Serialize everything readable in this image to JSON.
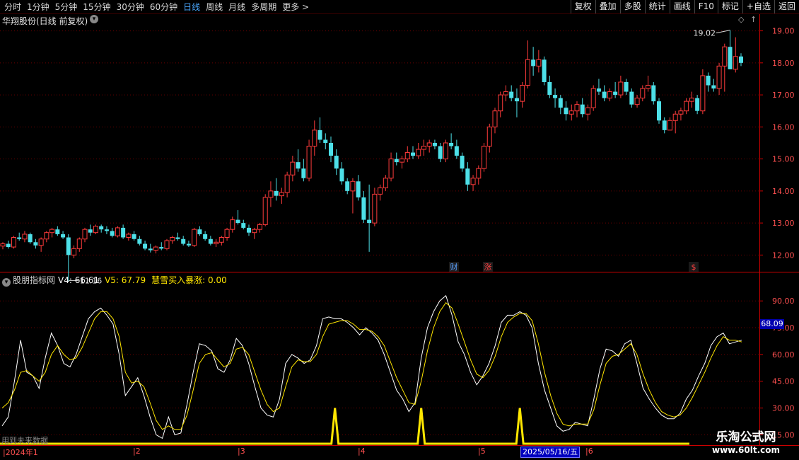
{
  "toolbar": {
    "periods": [
      "分时",
      "1分钟",
      "5分钟",
      "15分钟",
      "30分钟",
      "60分钟",
      "日线",
      "周线",
      "月线",
      "多周期",
      "更多 >"
    ],
    "active_period": 6,
    "right_tools": [
      "复权",
      "叠加",
      "多股",
      "统计",
      "画线",
      "F10",
      "标记",
      "+自选",
      "返回"
    ]
  },
  "main_title": "华翔股份(日线 前复权)",
  "dd_icon": "chevron-down-icon",
  "high_label": "19.02",
  "low_label": "11.16",
  "markers": [
    {
      "text": "财",
      "color": "#5aa0ff"
    },
    {
      "text": "涨",
      "color": "#ff4040"
    },
    {
      "text": "$",
      "color": "#ff4040"
    }
  ],
  "indicator": {
    "name": "股朋指标网",
    "v4_label": "V4: 66.61",
    "v5_label": "V5: 67.79",
    "boom_label": "慧雪买入暴涨: 0.00",
    "current_tag": "68.09"
  },
  "future_note": "用到未来数据",
  "date_axis": {
    "months": [
      "2024年1",
      "2",
      "3",
      "4",
      "5",
      "6"
    ],
    "cursor": "2025/05/16/五"
  },
  "watermark": {
    "name": "乐淘公式网",
    "url": "www.60lt.com"
  },
  "colors": {
    "up": "#ff3b3b",
    "down": "#4de0e8",
    "line_white": "#ffffff",
    "line_yellow": "#ffe600",
    "grid": "#6a0000",
    "axis": "#cc0000"
  },
  "chart_data": [
    {
      "type": "candlestick",
      "ylim": [
        11.5,
        19.3
      ],
      "yticks": [
        "12.00",
        "13.00",
        "14.00",
        "15.00",
        "16.00",
        "17.00",
        "18.00",
        "19.00"
      ],
      "ohlc": [
        [
          12.28,
          12.4,
          12.18,
          12.35
        ],
        [
          12.35,
          12.45,
          12.2,
          12.25
        ],
        [
          12.25,
          12.6,
          12.2,
          12.55
        ],
        [
          12.55,
          12.7,
          12.45,
          12.5
        ],
        [
          12.5,
          12.75,
          12.4,
          12.65
        ],
        [
          12.65,
          12.7,
          12.35,
          12.4
        ],
        [
          12.4,
          12.5,
          12.2,
          12.3
        ],
        [
          12.3,
          12.55,
          12.1,
          12.5
        ],
        [
          12.5,
          12.75,
          12.4,
          12.7
        ],
        [
          12.7,
          12.85,
          12.55,
          12.8
        ],
        [
          12.8,
          12.9,
          12.6,
          12.65
        ],
        [
          12.65,
          12.75,
          12.5,
          12.55
        ],
        [
          12.55,
          12.65,
          11.16,
          12.0
        ],
        [
          12.0,
          12.3,
          11.9,
          12.2
        ],
        [
          12.2,
          12.55,
          12.1,
          12.5
        ],
        [
          12.5,
          12.85,
          12.4,
          12.8
        ],
        [
          12.8,
          12.95,
          12.6,
          12.7
        ],
        [
          12.7,
          12.95,
          12.65,
          12.9
        ],
        [
          12.9,
          12.95,
          12.7,
          12.8
        ],
        [
          12.8,
          12.9,
          12.65,
          12.75
        ],
        [
          12.75,
          12.85,
          12.55,
          12.6
        ],
        [
          12.6,
          12.9,
          12.55,
          12.85
        ],
        [
          12.85,
          12.95,
          12.5,
          12.55
        ],
        [
          12.55,
          12.7,
          12.45,
          12.65
        ],
        [
          12.65,
          12.75,
          12.45,
          12.5
        ],
        [
          12.5,
          12.6,
          12.3,
          12.35
        ],
        [
          12.35,
          12.45,
          12.15,
          12.2
        ],
        [
          12.2,
          12.35,
          12.08,
          12.15
        ],
        [
          12.15,
          12.3,
          12.05,
          12.25
        ],
        [
          12.25,
          12.4,
          12.15,
          12.2
        ],
        [
          12.2,
          12.5,
          12.15,
          12.45
        ],
        [
          12.45,
          12.6,
          12.35,
          12.55
        ],
        [
          12.55,
          12.7,
          12.45,
          12.5
        ],
        [
          12.5,
          12.6,
          12.3,
          12.35
        ],
        [
          12.35,
          12.45,
          12.25,
          12.3
        ],
        [
          12.3,
          12.85,
          12.25,
          12.8
        ],
        [
          12.8,
          12.9,
          12.6,
          12.65
        ],
        [
          12.65,
          12.75,
          12.45,
          12.5
        ],
        [
          12.5,
          12.6,
          12.3,
          12.35
        ],
        [
          12.35,
          12.5,
          12.25,
          12.4
        ],
        [
          12.4,
          12.6,
          12.3,
          12.55
        ],
        [
          12.55,
          12.85,
          12.45,
          12.8
        ],
        [
          12.8,
          13.2,
          12.7,
          13.1
        ],
        [
          13.1,
          13.4,
          12.95,
          13.0
        ],
        [
          13.0,
          13.1,
          12.8,
          12.85
        ],
        [
          12.85,
          12.95,
          12.6,
          12.7
        ],
        [
          12.7,
          12.85,
          12.5,
          12.8
        ],
        [
          12.8,
          13.0,
          12.7,
          12.95
        ],
        [
          12.95,
          13.9,
          12.9,
          13.8
        ],
        [
          13.8,
          14.3,
          13.5,
          14.0
        ],
        [
          14.0,
          14.4,
          13.7,
          13.85
        ],
        [
          13.85,
          14.1,
          13.6,
          13.95
        ],
        [
          13.95,
          14.6,
          13.8,
          14.5
        ],
        [
          14.5,
          15.1,
          14.3,
          14.9
        ],
        [
          14.9,
          15.3,
          14.6,
          14.7
        ],
        [
          14.7,
          15.0,
          14.3,
          14.4
        ],
        [
          14.4,
          15.6,
          14.3,
          15.4
        ],
        [
          15.4,
          16.2,
          15.1,
          15.9
        ],
        [
          15.9,
          16.3,
          15.5,
          15.6
        ],
        [
          15.6,
          15.8,
          15.3,
          15.5
        ],
        [
          15.5,
          15.7,
          14.9,
          15.1
        ],
        [
          15.1,
          15.3,
          14.5,
          14.7
        ],
        [
          14.7,
          14.9,
          14.2,
          14.3
        ],
        [
          14.3,
          14.4,
          13.9,
          14.0
        ],
        [
          14.0,
          14.4,
          13.3,
          14.3
        ],
        [
          14.3,
          14.5,
          13.7,
          13.8
        ],
        [
          13.8,
          14.0,
          13.0,
          13.1
        ],
        [
          13.1,
          14.2,
          12.1,
          13.0
        ],
        [
          13.0,
          14.1,
          12.9,
          13.9
        ],
        [
          13.9,
          14.2,
          13.7,
          14.1
        ],
        [
          14.1,
          14.5,
          14.0,
          14.4
        ],
        [
          14.4,
          15.2,
          14.3,
          15.0
        ],
        [
          15.0,
          15.2,
          14.8,
          14.9
        ],
        [
          14.9,
          15.1,
          14.7,
          15.0
        ],
        [
          15.0,
          15.4,
          14.9,
          15.2
        ],
        [
          15.2,
          15.4,
          15.0,
          15.1
        ],
        [
          15.1,
          15.5,
          15.0,
          15.3
        ],
        [
          15.3,
          15.6,
          15.1,
          15.4
        ],
        [
          15.4,
          15.6,
          15.2,
          15.5
        ],
        [
          15.5,
          15.6,
          15.3,
          15.4
        ],
        [
          15.4,
          15.5,
          14.9,
          15.0
        ],
        [
          15.0,
          15.6,
          14.9,
          15.5
        ],
        [
          15.5,
          15.8,
          15.3,
          15.4
        ],
        [
          15.4,
          15.6,
          15.0,
          15.1
        ],
        [
          15.1,
          15.2,
          14.6,
          14.7
        ],
        [
          14.7,
          14.9,
          14.0,
          14.2
        ],
        [
          14.2,
          14.5,
          14.0,
          14.4
        ],
        [
          14.4,
          14.8,
          14.2,
          14.7
        ],
        [
          14.7,
          15.5,
          14.6,
          15.4
        ],
        [
          15.4,
          16.1,
          15.2,
          16.0
        ],
        [
          16.0,
          16.6,
          15.8,
          16.5
        ],
        [
          16.5,
          17.1,
          16.3,
          17.0
        ],
        [
          17.0,
          17.3,
          16.8,
          17.1
        ],
        [
          17.1,
          17.3,
          16.8,
          16.9
        ],
        [
          16.9,
          17.2,
          16.3,
          16.8
        ],
        [
          16.8,
          17.4,
          16.6,
          17.3
        ],
        [
          17.3,
          18.7,
          17.2,
          18.1
        ],
        [
          18.1,
          18.5,
          17.6,
          17.9
        ],
        [
          17.9,
          18.4,
          17.7,
          18.1
        ],
        [
          18.1,
          18.2,
          17.3,
          17.4
        ],
        [
          17.4,
          17.6,
          16.9,
          17.0
        ],
        [
          17.0,
          17.2,
          16.6,
          16.9
        ],
        [
          16.9,
          17.0,
          16.4,
          16.6
        ],
        [
          16.6,
          16.8,
          16.2,
          16.4
        ],
        [
          16.4,
          16.7,
          16.2,
          16.5
        ],
        [
          16.5,
          16.8,
          16.3,
          16.7
        ],
        [
          16.7,
          16.9,
          16.3,
          16.4
        ],
        [
          16.4,
          16.7,
          16.2,
          16.6
        ],
        [
          16.6,
          17.3,
          16.5,
          17.2
        ],
        [
          17.2,
          17.5,
          17.0,
          17.1
        ],
        [
          17.1,
          17.3,
          16.8,
          16.9
        ],
        [
          16.9,
          17.2,
          16.8,
          17.1
        ],
        [
          17.1,
          17.4,
          16.9,
          17.0
        ],
        [
          17.0,
          17.6,
          16.9,
          17.4
        ],
        [
          17.4,
          17.5,
          17.0,
          17.1
        ],
        [
          17.1,
          17.2,
          16.6,
          16.7
        ],
        [
          16.7,
          17.0,
          16.6,
          16.9
        ],
        [
          16.9,
          17.3,
          16.8,
          17.2
        ],
        [
          17.2,
          17.6,
          17.1,
          17.3
        ],
        [
          17.3,
          17.4,
          16.7,
          16.8
        ],
        [
          16.8,
          16.9,
          16.1,
          16.2
        ],
        [
          16.2,
          16.3,
          15.8,
          15.9
        ],
        [
          15.9,
          16.3,
          15.9,
          16.2
        ],
        [
          16.2,
          16.5,
          15.8,
          16.4
        ],
        [
          16.4,
          16.6,
          16.2,
          16.5
        ],
        [
          16.5,
          16.9,
          16.4,
          16.8
        ],
        [
          16.8,
          17.1,
          16.6,
          16.9
        ],
        [
          16.9,
          17.0,
          16.4,
          16.5
        ],
        [
          16.5,
          17.8,
          16.4,
          17.6
        ],
        [
          17.6,
          17.7,
          17.1,
          17.3
        ],
        [
          17.3,
          17.5,
          17.1,
          17.2
        ],
        [
          17.2,
          18.0,
          17.0,
          17.9
        ],
        [
          17.9,
          18.6,
          17.1,
          18.5
        ],
        [
          18.5,
          19.02,
          17.8,
          17.8
        ],
        [
          17.8,
          18.8,
          17.7,
          18.2
        ],
        [
          18.2,
          18.3,
          17.9,
          18.0
        ]
      ]
    },
    {
      "type": "line",
      "ylim": [
        10,
        100
      ],
      "yticks": [
        "15.00",
        "30.00",
        "45.00",
        "60.00",
        "75.00",
        "90.00"
      ],
      "series": [
        {
          "name": "V4",
          "values": [
            20,
            25,
            45,
            68,
            50,
            48,
            41,
            58,
            72,
            65,
            55,
            53,
            60,
            70,
            80,
            84,
            86,
            82,
            77,
            60,
            37,
            42,
            47,
            37,
            25,
            15,
            13,
            25,
            15,
            16,
            32,
            50,
            66,
            65,
            62,
            52,
            50,
            57,
            69,
            65,
            55,
            42,
            30,
            26,
            25,
            35,
            55,
            60,
            58,
            55,
            57,
            65,
            80,
            81,
            80,
            80,
            78,
            75,
            71,
            75,
            72,
            68,
            60,
            50,
            40,
            35,
            28,
            33,
            58,
            75,
            84,
            90,
            93,
            82,
            67,
            60,
            50,
            43,
            48,
            55,
            65,
            78,
            82,
            82,
            84,
            82,
            75,
            55,
            40,
            30,
            20,
            17,
            18,
            22,
            21,
            20,
            35,
            52,
            63,
            62,
            59,
            66,
            68,
            55,
            41,
            35,
            30,
            26,
            24,
            24,
            27,
            35,
            40,
            48,
            55,
            65,
            70,
            72,
            66,
            67,
            68
          ]
        },
        {
          "name": "V5",
          "values": [
            30,
            33,
            40,
            50,
            51,
            48,
            45,
            50,
            60,
            65,
            60,
            57,
            58,
            64,
            72,
            80,
            84,
            84,
            80,
            70,
            50,
            44,
            45,
            42,
            33,
            23,
            18,
            20,
            18,
            18,
            26,
            40,
            55,
            60,
            61,
            57,
            53,
            55,
            63,
            64,
            60,
            50,
            40,
            32,
            28,
            30,
            42,
            53,
            57,
            56,
            56,
            60,
            70,
            77,
            78,
            79,
            79,
            77,
            74,
            74,
            73,
            70,
            65,
            56,
            47,
            40,
            33,
            32,
            45,
            62,
            75,
            84,
            89,
            86,
            77,
            67,
            57,
            49,
            47,
            51,
            59,
            70,
            78,
            81,
            83,
            83,
            79,
            66,
            50,
            37,
            27,
            21,
            20,
            21,
            21,
            21,
            29,
            43,
            55,
            59,
            60,
            63,
            66,
            60,
            49,
            40,
            33,
            28,
            26,
            25,
            26,
            30,
            36,
            43,
            50,
            58,
            65,
            70,
            68,
            68,
            67
          ]
        },
        {
          "name": "慧雪买入暴涨",
          "values": [
            0,
            0,
            0,
            0,
            0,
            0,
            0,
            0,
            0,
            0,
            0,
            0,
            0,
            0,
            0,
            0,
            0,
            0,
            0,
            0,
            0,
            0,
            0,
            0,
            0,
            0,
            0,
            0,
            0,
            0,
            0,
            0,
            0,
            0,
            0,
            0,
            0,
            0,
            0,
            0,
            0,
            0,
            0,
            0,
            0,
            0,
            0,
            0,
            0,
            0,
            0,
            0,
            0,
            0,
            1,
            0,
            0,
            0,
            0,
            0,
            0,
            0,
            0,
            0,
            0,
            0,
            0,
            0,
            1,
            0,
            0,
            0,
            0,
            0,
            0,
            0,
            0,
            0,
            0,
            0,
            0,
            0,
            0,
            0,
            1,
            0,
            0,
            0,
            0,
            0,
            0,
            0,
            0,
            0,
            0,
            0,
            0,
            0,
            0,
            0,
            0,
            0,
            0,
            0,
            0,
            0,
            0,
            0,
            0,
            0,
            0,
            0,
            0,
            0,
            0,
            0,
            0,
            0,
            0,
            0,
            0
          ]
        }
      ]
    }
  ]
}
